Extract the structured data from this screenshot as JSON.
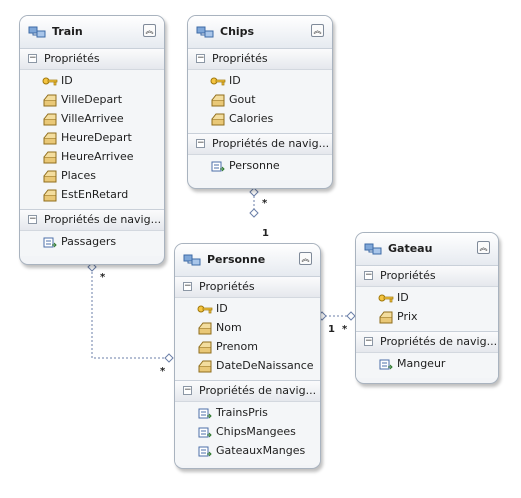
{
  "entities": {
    "train": {
      "title": "Train",
      "properties_header": "Propriétés",
      "properties": [
        "ID",
        "VilleDepart",
        "VilleArrivee",
        "HeureDepart",
        "HeureArrivee",
        "Places",
        "EstEnRetard"
      ],
      "nav_header": "Propriétés de navig...",
      "navigation": [
        "Passagers"
      ]
    },
    "chips": {
      "title": "Chips",
      "properties_header": "Propriétés",
      "properties": [
        "ID",
        "Gout",
        "Calories"
      ],
      "nav_header": "Propriétés de navig...",
      "navigation": [
        "Personne"
      ]
    },
    "personne": {
      "title": "Personne",
      "properties_header": "Propriétés",
      "properties": [
        "ID",
        "Nom",
        "Prenom",
        "DateDeNaissance"
      ],
      "nav_header": "Propriétés de navig...",
      "navigation": [
        "TrainsPris",
        "ChipsMangees",
        "GateauxManges"
      ]
    },
    "gateau": {
      "title": "Gateau",
      "properties_header": "Propriétés",
      "properties": [
        "ID",
        "Prix"
      ],
      "nav_header": "Propriétés de navig...",
      "navigation": [
        "Mangeur"
      ]
    }
  },
  "associations": {
    "chips_personne": {
      "chips_end": "*",
      "personne_end": "1"
    },
    "train_personne": {
      "train_end": "*",
      "personne_end": "*"
    },
    "personne_gateau": {
      "personne_end": "1",
      "gateau_end": "*"
    }
  }
}
